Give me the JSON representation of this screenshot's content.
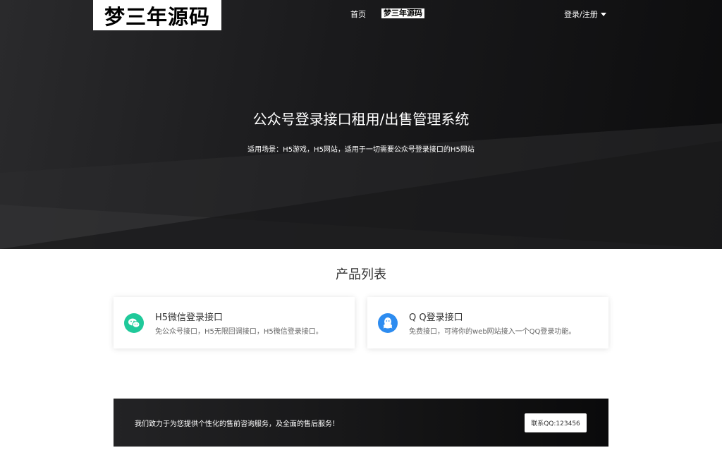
{
  "header": {
    "logo_text": "梦三年源码",
    "nav_home": "首页",
    "nav_brand": "梦三年源码",
    "login_label": "登录/注册"
  },
  "hero": {
    "title": "公众号登录接口租用/出售管理系统",
    "subtitle": "适用场景：H5游戏，H5网站，适用于一切需要公众号登录接口的H5网站"
  },
  "products": {
    "section_title": "产品列表",
    "items": [
      {
        "title": "H5微信登录接口",
        "desc": "免公众号接口，H5无限回调接口，H5微信登录接口。",
        "icon": "wechat-icon",
        "color": "#1fc99a"
      },
      {
        "title": "Q Q登录接口",
        "desc": "免费接口，可将你的web网站接入一个QQ登录功能。",
        "icon": "qq-icon",
        "color": "#2d8cf0"
      }
    ]
  },
  "cta": {
    "text": "我们致力于为您提供个性化的售前咨询服务，及全面的售后服务！",
    "button_label": "联系QQ:123456"
  }
}
